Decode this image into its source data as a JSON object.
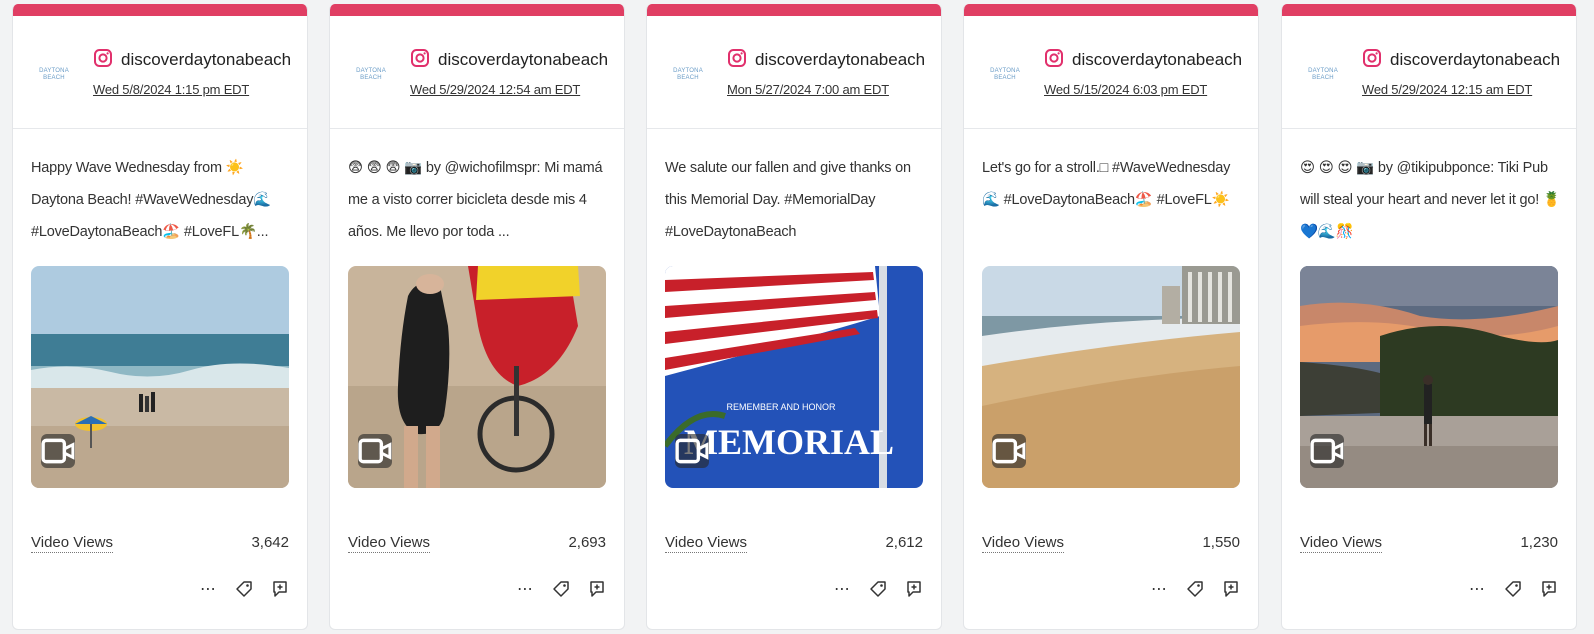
{
  "cards": [
    {
      "brand_logo": "DAYTONA BEACH",
      "handle": "discoverdaytonabeach",
      "timestamp": "Wed 5/8/2024 1:15 pm EDT",
      "caption": "Happy Wave Wednesday from ☀️ Daytona Beach! #WaveWednesday🌊 #LoveDaytonaBeach🏖️ #LoveFL🌴...",
      "media_type": "video",
      "metric_label": "Video Views",
      "metric_value": "3,642"
    },
    {
      "brand_logo": "DAYTONA BEACH",
      "handle": "discoverdaytonabeach",
      "timestamp": "Wed 5/29/2024 12:54 am EDT",
      "caption": "😨 😨 😨 📷 by @wichofilmspr: Mi mamá me a visto correr bicicleta desde mis 4 años. Me llevo por toda ...",
      "media_type": "video",
      "metric_label": "Video Views",
      "metric_value": "2,693"
    },
    {
      "brand_logo": "DAYTONA BEACH",
      "handle": "discoverdaytonabeach",
      "timestamp": "Mon 5/27/2024 7:00 am EDT",
      "caption": "We salute our fallen and give thanks on this Memorial Day. #MemorialDay #LoveDaytonaBeach",
      "media_type": "video",
      "media_text_small": "REMEMBER AND HONOR",
      "media_text_large": "MEMORIAL",
      "metric_label": "Video Views",
      "metric_value": "2,612"
    },
    {
      "brand_logo": "DAYTONA BEACH",
      "handle": "discoverdaytonabeach",
      "timestamp": "Wed 5/15/2024 6:03 pm EDT",
      "caption": "Let's go for a stroll.□ #WaveWednesday🌊 #LoveDaytonaBeach🏖️ #LoveFL☀️",
      "media_type": "video",
      "metric_label": "Video Views",
      "metric_value": "1,550"
    },
    {
      "brand_logo": "DAYTONA BEACH",
      "handle": "discoverdaytonabeach",
      "timestamp": "Wed 5/29/2024 12:15 am EDT",
      "caption": "😍 😍 😍 📷 by @tikipubponce: Tiki Pub will steal your heart and never let it go! 🍍💙🌊🎊",
      "media_type": "video",
      "metric_label": "Video Views",
      "metric_value": "1,230"
    }
  ],
  "colors": {
    "accent_bar": "#e03e63",
    "instagram": "#e1306c"
  },
  "icons": {
    "network": "instagram-icon",
    "media": "video-icon",
    "more": "more-icon",
    "tag": "tag-icon",
    "reply": "reply-icon"
  }
}
